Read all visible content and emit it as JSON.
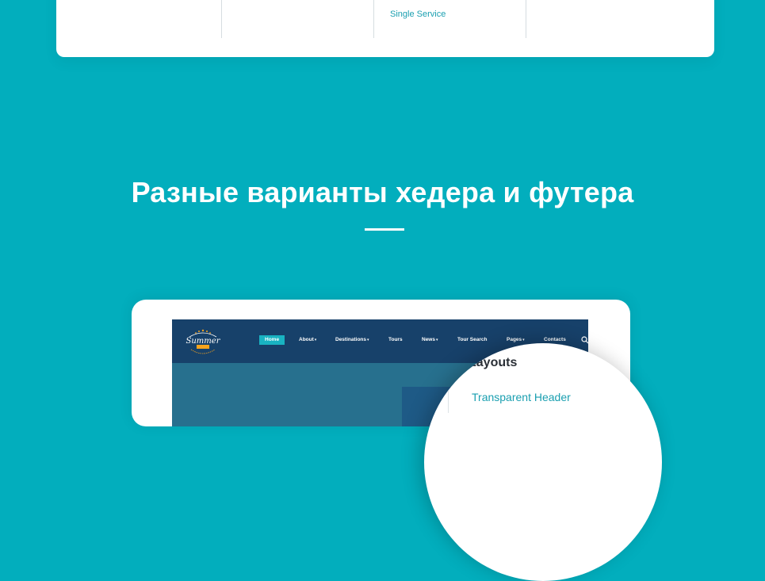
{
  "top_card": {
    "link_text": "Single Service"
  },
  "section": {
    "title": "Разные варианты хедера и футера"
  },
  "preview": {
    "logo_text": "Summer",
    "nav": [
      {
        "label": "Home",
        "active": true,
        "has_caret": false
      },
      {
        "label": "About",
        "active": false,
        "has_caret": true
      },
      {
        "label": "Destinations",
        "active": false,
        "has_caret": true
      },
      {
        "label": "Tours",
        "active": false,
        "has_caret": false
      },
      {
        "label": "News",
        "active": false,
        "has_caret": true
      },
      {
        "label": "Tour Search",
        "active": false,
        "has_caret": false
      },
      {
        "label": "Pages",
        "active": false,
        "has_caret": true
      },
      {
        "label": "Contacts",
        "active": false,
        "has_caret": false
      }
    ],
    "caret_glyph": "▾"
  },
  "zoom": {
    "heading": "Layouts",
    "item": "Transparent Header"
  },
  "colors": {
    "background": "#02aebd",
    "accent": "#1a9fb0",
    "nav_bg": "#17416a",
    "active_nav": "#19b3c2"
  }
}
